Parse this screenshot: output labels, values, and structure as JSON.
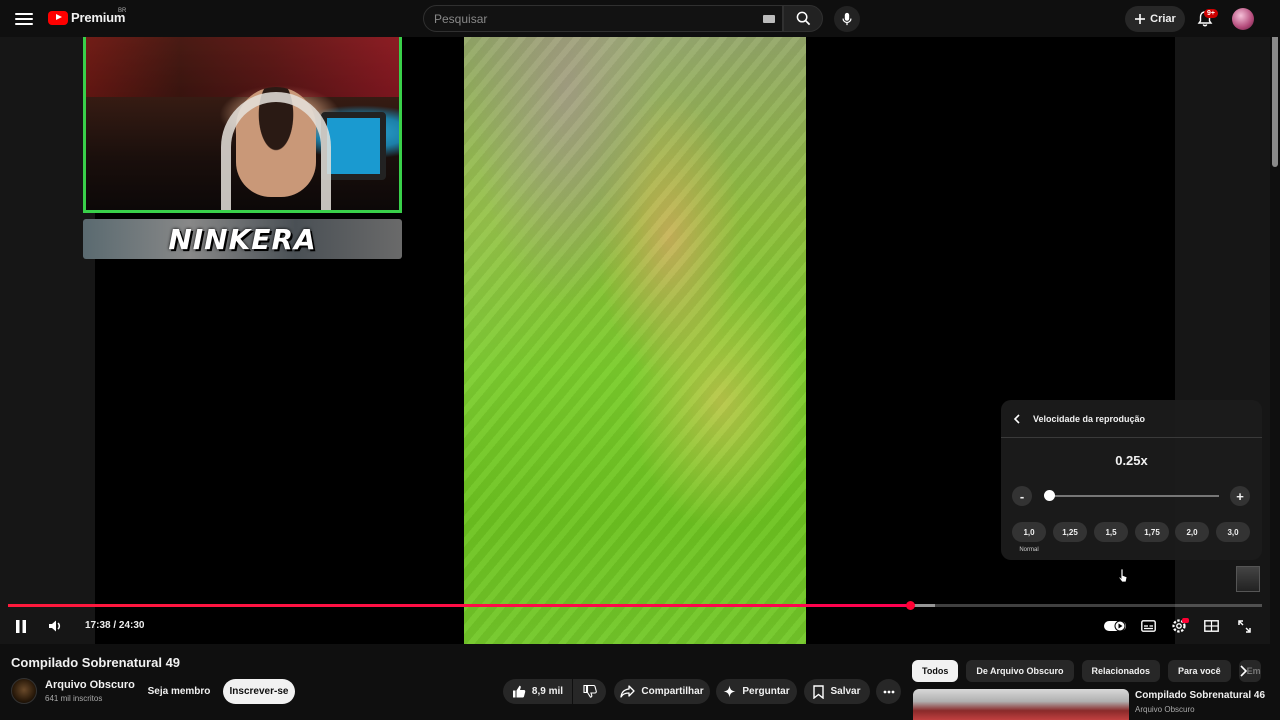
{
  "header": {
    "logo_text": "Premium",
    "logo_country": "BR",
    "search_placeholder": "Pesquisar",
    "create_label": "Criar",
    "notification_badge": "9+"
  },
  "player": {
    "overlay_name": "NINKERA",
    "time_current": "17:38",
    "time_separator": " / ",
    "time_total": "24:30",
    "progress_played_fraction": 0.7197,
    "progress_buffered_fraction": 0.7395
  },
  "speed_menu": {
    "title": "Velocidade da reprodução",
    "current_value": "0.25x",
    "current_speed": 0.25,
    "min_speed": 0.25,
    "max_speed": 4,
    "minus_label": "-",
    "plus_label": "+",
    "presets": [
      "1,0",
      "1,25",
      "1,5",
      "1,75",
      "2,0",
      "3,0"
    ],
    "normal_label": "Normal"
  },
  "video": {
    "title": "Compilado Sobrenatural 49",
    "channel": "Arquivo Obscuro",
    "subscribers": "641 mil inscritos",
    "member_label": "Seja membro",
    "subscribe_label": "Inscrever-se",
    "likes": "8,9 mil",
    "share_label": "Compartilhar",
    "ask_label": "Perguntar",
    "save_label": "Salvar"
  },
  "sidebar": {
    "chips": [
      "Todos",
      "De Arquivo Obscuro",
      "Relacionados",
      "Para você",
      "Em"
    ],
    "recommendation": {
      "title": "Compilado Sobrenatural 46",
      "channel": "Arquivo Obscuro"
    }
  },
  "colors": {
    "accent_red": "#ff0033",
    "webcam_border": "#39d04a",
    "background": "#0f0f0f"
  }
}
